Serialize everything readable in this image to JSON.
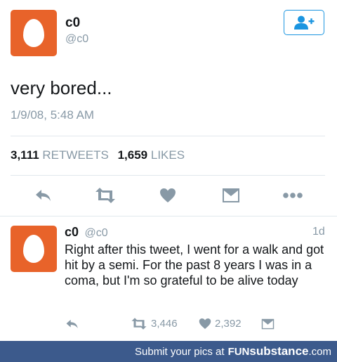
{
  "main_tweet": {
    "display_name": "c0",
    "handle": "@c0",
    "text": "very bored...",
    "timestamp": "1/9/08, 5:48 AM",
    "retweets_count": "3,111",
    "retweets_label": "RETWEETS",
    "likes_count": "1,659",
    "likes_label": "LIKES",
    "avatar_color": "#e8632a"
  },
  "follow_button": {
    "icon": "add-user-icon",
    "color": "#1b95e0"
  },
  "actions": [
    "reply-icon",
    "retweet-icon",
    "like-icon",
    "message-icon",
    "more-icon"
  ],
  "reply_tweet": {
    "display_name": "c0",
    "handle": "@c0",
    "time": "1d",
    "text": "Right after this tweet, I went for a walk and got hit by a semi. For the past 8 years I was in a coma, but I'm so grateful to be alive today",
    "retweets": "3,446",
    "likes": "2,392"
  },
  "footer": {
    "prefix": "Submit your pics at",
    "brand_bold": "FUN",
    "brand_rest": "substance",
    "brand_tld": ".com",
    "color": "#3c5a8c"
  }
}
